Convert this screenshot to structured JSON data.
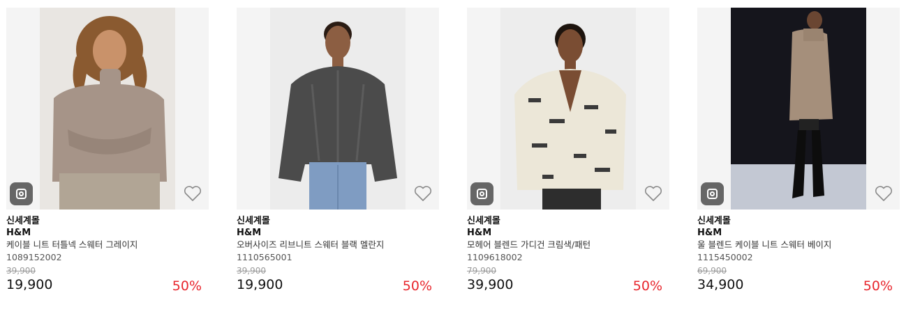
{
  "colors": {
    "discount": "#e8262d",
    "image_bg": "#f4f4f4",
    "insta_badge": "#666666"
  },
  "icons": {
    "instagram": "instagram-icon",
    "wishlist": "heart-outline-icon"
  },
  "products": [
    {
      "shop": "신세계몰",
      "brand": "H&M",
      "name": "케이블 니트 터틀넥 스웨터 그레이지",
      "code": "1089152002",
      "original_price": "39,900",
      "price": "19,900",
      "discount": "50%",
      "has_instagram_badge": true
    },
    {
      "shop": "신세계몰",
      "brand": "H&M",
      "name": "오버사이즈 리브니트 스웨터 블랙 멜란지",
      "code": "1110565001",
      "original_price": "39,900",
      "price": "19,900",
      "discount": "50%",
      "has_instagram_badge": false
    },
    {
      "shop": "신세계몰",
      "brand": "H&M",
      "name": "모헤어 블렌드 가디건 크림색/패턴",
      "code": "1109618002",
      "original_price": "79,900",
      "price": "39,900",
      "discount": "50%",
      "has_instagram_badge": true
    },
    {
      "shop": "신세계몰",
      "brand": "H&M",
      "name": "울 블렌드 케이블 니트 스웨터 베이지",
      "code": "1115450002",
      "original_price": "69,900",
      "price": "34,900",
      "discount": "50%",
      "has_instagram_badge": true
    }
  ]
}
